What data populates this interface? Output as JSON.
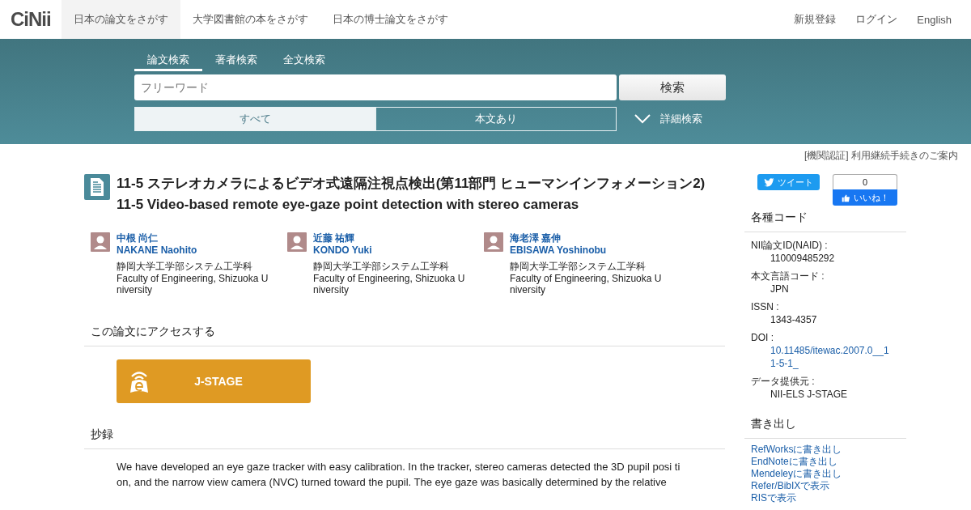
{
  "header": {
    "logo": "CiNii",
    "nav": [
      {
        "label": "日本の論文をさがす",
        "selected": true
      },
      {
        "label": "大学図書館の本をさがす",
        "selected": false
      },
      {
        "label": "日本の博士論文をさがす",
        "selected": false
      }
    ],
    "links": [
      "新規登録",
      "ログイン",
      "English"
    ]
  },
  "search": {
    "tabs": [
      {
        "label": "論文検索",
        "selected": true
      },
      {
        "label": "著者検索",
        "selected": false
      },
      {
        "label": "全文検索",
        "selected": false
      }
    ],
    "placeholder": "フリーワード",
    "button": "検索",
    "filters": [
      {
        "label": "すべて",
        "selected": true
      },
      {
        "label": "本文あり",
        "selected": false
      }
    ],
    "advanced": "詳細検索"
  },
  "notice": "[機関認証] 利用継続手続きのご案内",
  "article": {
    "title_ja": "11-5 ステレオカメラによるビデオ式遠隔注視点検出(第11部門 ヒューマンインフォメーション2)",
    "title_en": "11-5 Video-based remote eye-gaze point detection with stereo cameras",
    "authors": [
      {
        "name_ja": "中根 尚仁",
        "name_en": "NAKANE Naohito",
        "affil_ja": "静岡大学工学部システム工学科",
        "affil_en": "Faculty of Engineering, Shizuoka U niversity"
      },
      {
        "name_ja": "近藤 祐輝",
        "name_en": "KONDO Yuki",
        "affil_ja": "静岡大学工学部システム工学科",
        "affil_en": "Faculty of Engineering, Shizuoka U niversity"
      },
      {
        "name_ja": "海老澤 嘉伸",
        "name_en": "EBISAWA Yoshinobu",
        "affil_ja": "静岡大学工学部システム工学科",
        "affil_en": "Faculty of Engineering, Shizuoka U niversity"
      }
    ],
    "access_heading": "この論文にアクセスする",
    "access_button": "J-STAGE",
    "abstract_heading": "抄録",
    "abstract": "We have developed an eye gaze tracker with easy calibration. In the tracker, stereo cameras detected the 3D pupil posi tion, and the narrow view camera (NVC) turned toward the pupil. The eye gaze was basically determined by the relative"
  },
  "sidebar": {
    "tweet": "ツイート",
    "like_count": "0",
    "like": "いいね！",
    "codes_heading": "各種コード",
    "codes": [
      {
        "label": "NII論文ID(NAID) :",
        "value": "110009485292",
        "kind": "text"
      },
      {
        "label": "本文言語コード :",
        "value": "JPN",
        "kind": "text"
      },
      {
        "label": "ISSN :",
        "value": "1343-4357",
        "kind": "text"
      },
      {
        "label": "DOI :",
        "value": "10.11485/itewac.2007.0__11-5-1_",
        "kind": "link"
      },
      {
        "label": "データ提供元 :",
        "value": "NII-ELS  J-STAGE",
        "kind": "text"
      }
    ],
    "export_heading": "書き出し",
    "exports": [
      "RefWorksに書き出し",
      "EndNoteに書き出し",
      "Mendeleyに書き出し",
      "Refer/BibIXで表示",
      "RISで表示"
    ]
  }
}
